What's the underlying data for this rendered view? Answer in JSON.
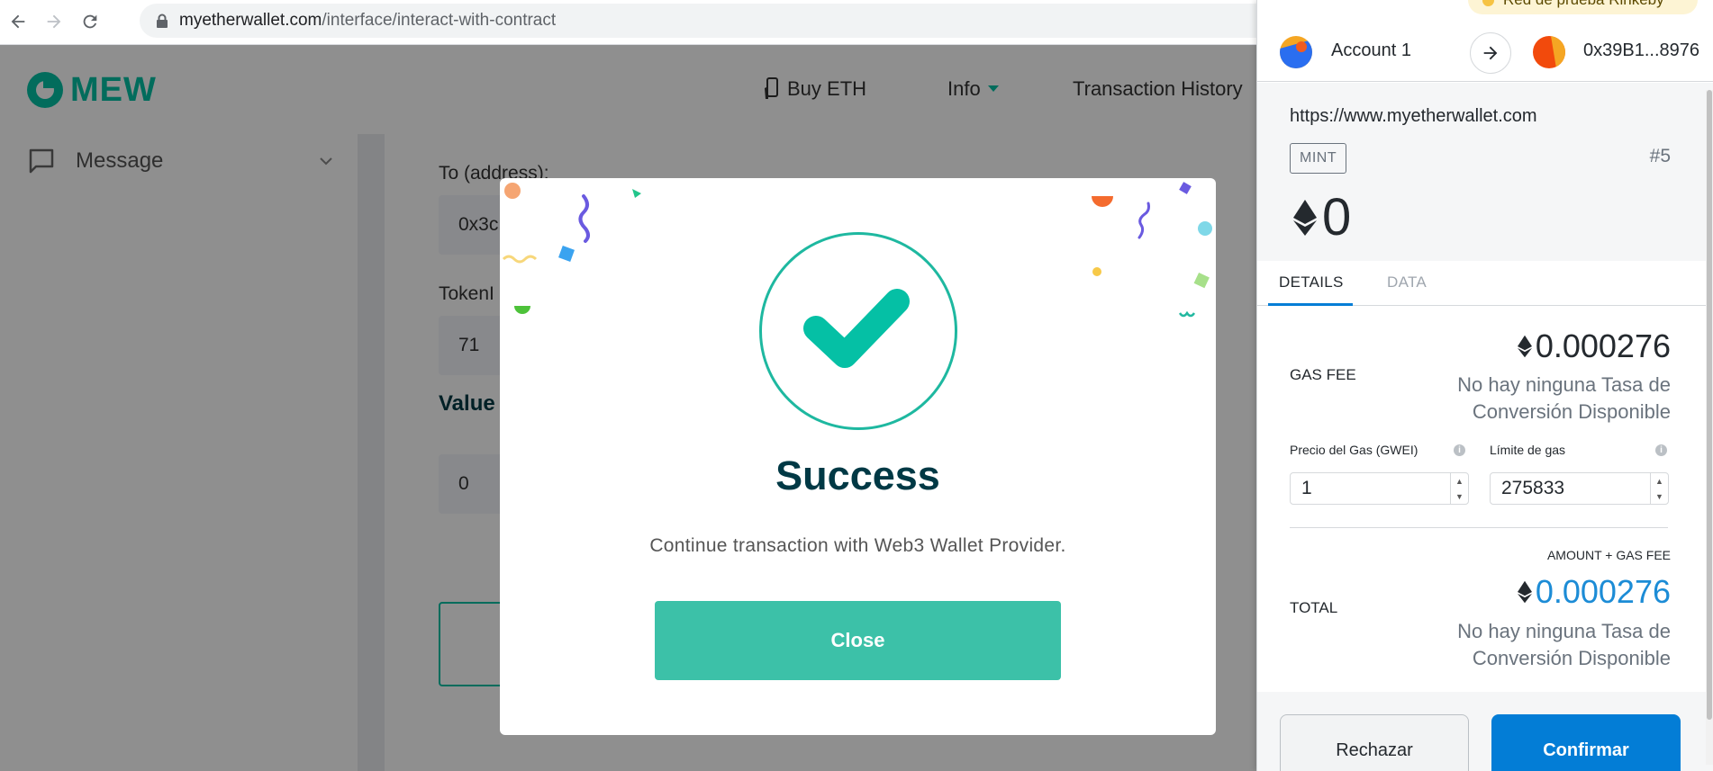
{
  "browser": {
    "url_host": "myetherwallet.com",
    "url_path": "/interface/interact-with-contract"
  },
  "mew": {
    "logo_text": "MEW",
    "nav": {
      "buy_eth": "Buy ETH",
      "info": "Info",
      "transaction_history": "Transaction History"
    },
    "sidebar": {
      "message_label": "Message"
    },
    "form": {
      "to_label": "To (address):",
      "to_value": "0x3c",
      "token_label": "TokenI",
      "token_value": "71",
      "value_title": "Value",
      "value_input": "0"
    }
  },
  "modal": {
    "title": "Success",
    "message": "Continue transaction with Web3 Wallet Provider.",
    "close_label": "Close"
  },
  "metamask": {
    "network": "Red de prueba Rinkeby",
    "account_name": "Account 1",
    "to_address": "0x39B1...8976",
    "origin": "https://www.myetherwallet.com",
    "method": "MINT",
    "nonce": "#5",
    "eth_amount": "0",
    "tabs": {
      "details": "DETAILS",
      "data": "DATA"
    },
    "gas_fee_label": "GAS FEE",
    "gas_fee_value": "0.000276",
    "conversion_unavailable_line1": "No hay ninguna Tasa de",
    "conversion_unavailable_line2": "Conversión Disponible",
    "gas_price_label": "Precio del Gas (GWEI)",
    "gas_price_value": "1",
    "gas_limit_label": "Límite de gas",
    "gas_limit_value": "275833",
    "amount_gas_fee_label": "AMOUNT + GAS FEE",
    "total_label": "TOTAL",
    "total_value": "0.000276",
    "reject_label": "Rechazar",
    "confirm_label": "Confirmar"
  },
  "colors": {
    "mew_green": "#05c0a5",
    "close_button": "#3cc1a8",
    "metamask_blue": "#037dd6",
    "success_title": "#003945"
  }
}
